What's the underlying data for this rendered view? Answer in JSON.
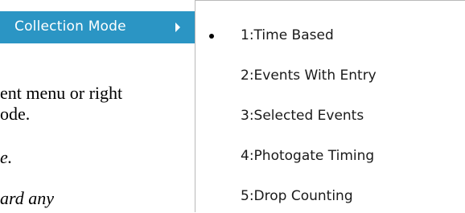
{
  "menu": {
    "parent_label": "Collection Mode",
    "parent_arrow_icon": "chevron-right-icon",
    "highlight_color": "#2b95c4"
  },
  "background_text": {
    "line1": "ent menu or right",
    "line2": "ode.",
    "line3": "e.",
    "line4": "ard any"
  },
  "submenu": {
    "items": [
      {
        "label": "1:Time Based",
        "selected": true
      },
      {
        "label": "2:Events With Entry",
        "selected": false
      },
      {
        "label": "3:Selected Events",
        "selected": false
      },
      {
        "label": "4:Photogate Timing",
        "selected": false
      },
      {
        "label": "5:Drop Counting",
        "selected": false
      }
    ]
  }
}
